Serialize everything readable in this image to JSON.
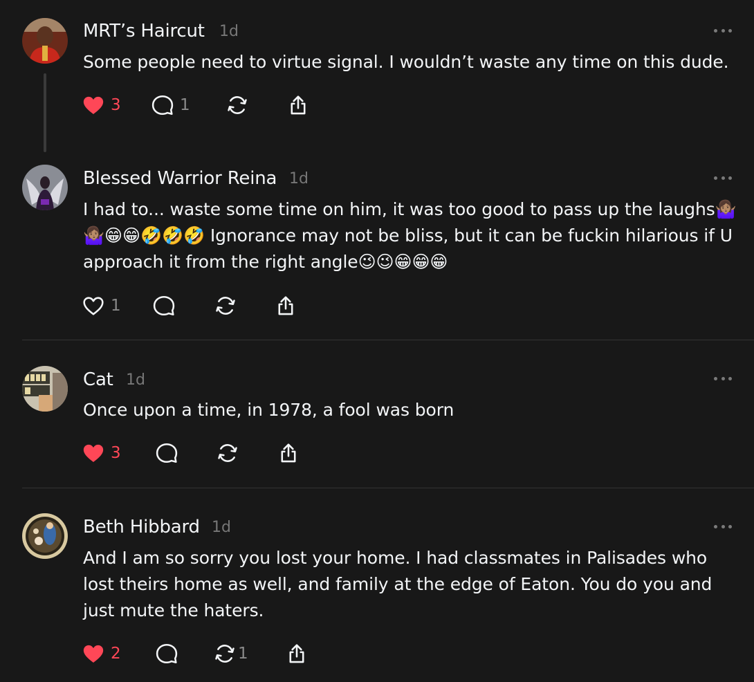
{
  "colors": {
    "background": "#181818",
    "text": "#f3f5f7",
    "muted": "#777777",
    "like_red": "#ff4757",
    "divider": "#333333"
  },
  "posts": [
    {
      "author": "MRT’s Haircut",
      "time": "1d",
      "text": "Some people need to virtue signal. I wouldn’t waste any time on this dude.",
      "liked": true,
      "likes": "3",
      "replies": "1",
      "reposts": "",
      "icons": [
        "heart-filled-icon",
        "comment-icon",
        "repost-icon",
        "share-icon"
      ]
    },
    {
      "author": "Blessed Warrior Reina",
      "time": "1d",
      "text_lines": [
        "I had to... waste some time on him, it was too good to pass up the laughs🤷🏽‍♀️",
        "🤷🏽‍♀️😁😁🤣🤣🤣 Ignorance may not be bliss, but it can be fuckin hilarious if U",
        "approach it from the right angle😉😉😁😁😁"
      ],
      "liked": false,
      "likes": "1",
      "replies": "",
      "reposts": "",
      "icons": [
        "heart-outline-icon",
        "comment-icon",
        "repost-icon",
        "share-icon"
      ]
    },
    {
      "author": "Cat",
      "time": "1d",
      "text": "Once upon a time, in 1978, a fool was born",
      "liked": true,
      "likes": "3",
      "replies": "",
      "reposts": "",
      "icons": [
        "heart-filled-icon",
        "comment-icon",
        "repost-icon",
        "share-icon"
      ]
    },
    {
      "author": "Beth Hibbard",
      "time": "1d",
      "text_lines": [
        "And I am so sorry you lost your home. I had classmates in Palisades who",
        "lost theirs home as well, and family at the edge of Eaton. You do you and",
        "just mute the haters."
      ],
      "liked": true,
      "likes": "2",
      "replies": "",
      "reposts": "1",
      "icons": [
        "heart-filled-icon",
        "comment-icon",
        "repost-icon",
        "share-icon"
      ]
    }
  ]
}
